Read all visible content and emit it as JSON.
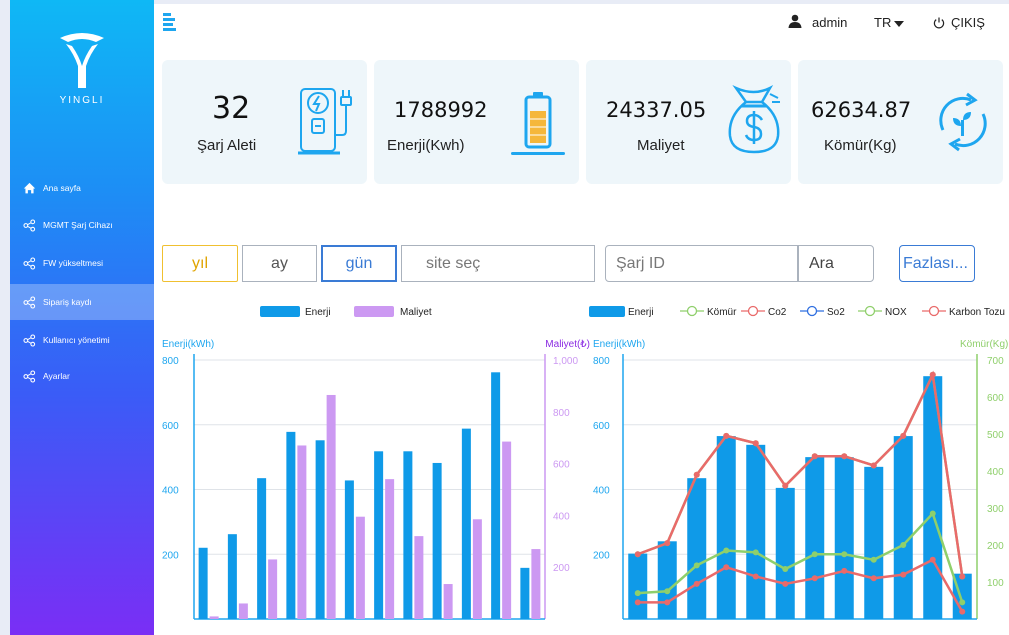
{
  "brand": {
    "name": "YINGLI"
  },
  "sidebar": {
    "items": [
      {
        "label": "Ana sayfa",
        "icon": "home-icon",
        "active": false
      },
      {
        "label": "MGMT Şarj Cihazı",
        "icon": "share-icon",
        "active": false
      },
      {
        "label": "FW yükseltmesi",
        "icon": "share-icon",
        "active": false
      },
      {
        "label": "Sipariş kaydı",
        "icon": "share-icon",
        "active": true
      },
      {
        "label": "Kullanıcı yönetimi",
        "icon": "share-icon",
        "active": false
      },
      {
        "label": "Ayarlar",
        "icon": "share-icon",
        "active": false
      }
    ]
  },
  "header": {
    "user": "admin",
    "language": "TR",
    "logout": "ÇIKIŞ"
  },
  "cards": [
    {
      "value": "32",
      "label": "Şarj Aleti",
      "icon": "charging-station-icon"
    },
    {
      "value": "1788992",
      "label": "Enerji(Kwh)",
      "icon": "battery-icon"
    },
    {
      "value": "24337.05",
      "label": "Maliyet",
      "icon": "money-bag-icon"
    },
    {
      "value": "62634.87",
      "label": "Kömür(Kg)",
      "icon": "recycle-leaf-icon"
    }
  ],
  "filters": {
    "year": "yıl",
    "month": "ay",
    "day": "gün",
    "site_placeholder": "site seç",
    "charger_id_placeholder": "Şarj ID",
    "search": "Ara",
    "more": "Fazlası..."
  },
  "colors": {
    "accent": "#1ea6ef",
    "bar_blue": "#0f9ae8",
    "bar_purple": "#cc99f2",
    "line_red": "#e96a6a",
    "line_green": "#8fcf6b",
    "year_border": "#f0c030",
    "day_border": "#3a7bd5"
  },
  "chart_data": [
    {
      "type": "bar",
      "legend": [
        "Enerji",
        "Maliyet"
      ],
      "yLeftLabel": "Enerji(kWh)",
      "yRightLabel": "Maliyet(₺)",
      "yLeftTicks": [
        "800",
        "600",
        "400",
        "200"
      ],
      "yRightTicks": [
        "1,000",
        "800",
        "600",
        "400",
        "200"
      ],
      "ylimLeft": [
        0,
        800
      ],
      "ylimRight": [
        0,
        1000
      ],
      "series": [
        {
          "name": "Enerji",
          "axis": "left",
          "values": [
            220,
            262,
            435,
            578,
            552,
            428,
            518,
            518,
            482,
            588,
            762,
            158
          ]
        },
        {
          "name": "Maliyet",
          "axis": "right",
          "values": [
            10,
            60,
            230,
            670,
            865,
            395,
            540,
            320,
            135,
            385,
            685,
            270
          ]
        }
      ]
    },
    {
      "type": "bar+line",
      "legend": [
        "Enerji",
        "Kömür",
        "Co2",
        "So2",
        "NOX",
        "Karbon Tozu"
      ],
      "yLeftLabel": "Enerji(kWh)",
      "yRightLabel": "Kömür(Kg)",
      "yLeftTicks": [
        "800",
        "600",
        "400",
        "200"
      ],
      "yRightTicks": [
        "700",
        "600",
        "500",
        "400",
        "300",
        "200",
        "100"
      ],
      "ylimLeft": [
        0,
        800
      ],
      "ylimRight": [
        0,
        700
      ],
      "series": [
        {
          "name": "Enerji",
          "kind": "bar",
          "axis": "left",
          "values": [
            202,
            240,
            435,
            565,
            538,
            405,
            500,
            500,
            470,
            565,
            750,
            140
          ]
        },
        {
          "name": "Kömür",
          "kind": "line",
          "axis": "right",
          "values": [
            175,
            205,
            390,
            495,
            475,
            360,
            440,
            440,
            415,
            495,
            660,
            115
          ]
        },
        {
          "name": "Co2",
          "kind": "line",
          "axis": "right",
          "values": [
            175,
            205,
            390,
            495,
            475,
            360,
            440,
            440,
            415,
            495,
            660,
            115
          ]
        },
        {
          "name": "NOX",
          "kind": "line",
          "axis": "right",
          "values": [
            70,
            75,
            145,
            185,
            180,
            135,
            175,
            175,
            160,
            200,
            285,
            45
          ]
        },
        {
          "name": "Karbon Tozu",
          "kind": "line",
          "axis": "right",
          "values": [
            45,
            45,
            95,
            140,
            115,
            95,
            110,
            130,
            110,
            120,
            160,
            20
          ]
        }
      ]
    }
  ]
}
